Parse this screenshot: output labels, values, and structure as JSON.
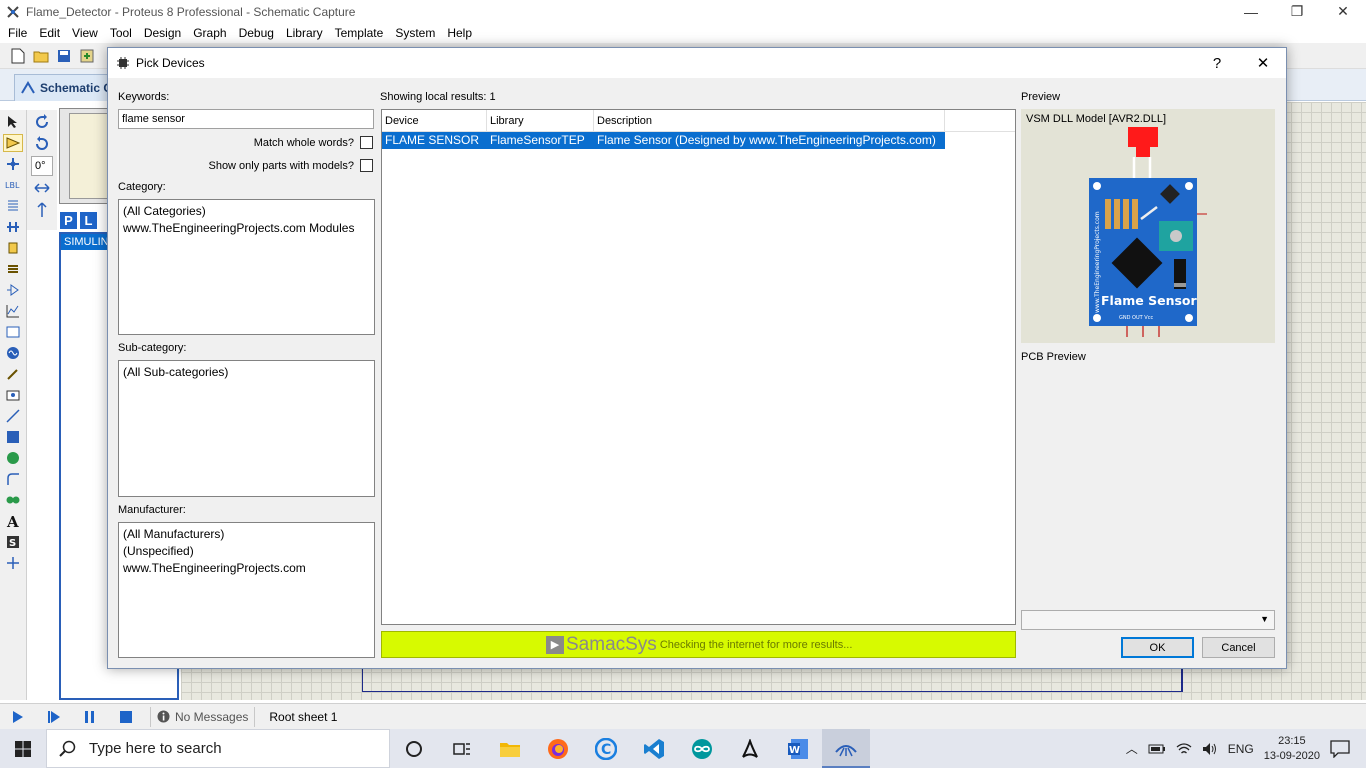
{
  "window": {
    "title": "Flame_Detector - Proteus 8 Professional - Schematic Capture",
    "minimize": "—",
    "restore": "❐",
    "close": "✕"
  },
  "menu": [
    "File",
    "Edit",
    "View",
    "Tool",
    "Design",
    "Graph",
    "Debug",
    "Library",
    "Template",
    "System",
    "Help"
  ],
  "tab": {
    "label": "Schematic C"
  },
  "left_panel": {
    "angle": "0°",
    "p_button": "P",
    "l_button": "L",
    "device_item": "SIMULIN"
  },
  "status": {
    "messages": "No Messages",
    "sheet": "Root sheet 1"
  },
  "dialog": {
    "title": "Pick Devices",
    "help": "?",
    "close": "✕",
    "keywords_label": "Keywords:",
    "keywords_value": "flame sensor",
    "match_whole_words": "Match whole words?",
    "show_only_models": "Show only parts with models?",
    "category_label": "Category:",
    "categories": [
      "(All Categories)",
      "www.TheEngineeringProjects.com Modules"
    ],
    "subcategory_label": "Sub-category:",
    "subcategories": [
      "(All Sub-categories)"
    ],
    "manufacturer_label": "Manufacturer:",
    "manufacturers": [
      "(All Manufacturers)",
      "(Unspecified)",
      "www.TheEngineeringProjects.com"
    ],
    "results_label": "Showing local results: 1",
    "columns": [
      "Device",
      "Library",
      "Description"
    ],
    "rows": [
      {
        "device": "FLAME SENSOR",
        "library": "FlameSensorTEP",
        "description": "Flame Sensor (Designed by www.TheEngineeringProjects.com)"
      }
    ],
    "samacsys_logo": "SamacSys",
    "samacsys_message": "Checking the internet for more results...",
    "preview_label": "Preview",
    "preview_model": "VSM DLL Model [AVR2.DLL]",
    "pcb_preview_label": "PCB Preview",
    "ok": "OK",
    "cancel": "Cancel",
    "board_text": "Flame Sensor",
    "board_side_text": "www.TheEngineeringProjects.com",
    "pins_text": "GND OUT Vcc"
  },
  "taskbar": {
    "search_placeholder": "Type here to search",
    "language": "ENG",
    "time": "23:15",
    "date": "13-09-2020"
  }
}
